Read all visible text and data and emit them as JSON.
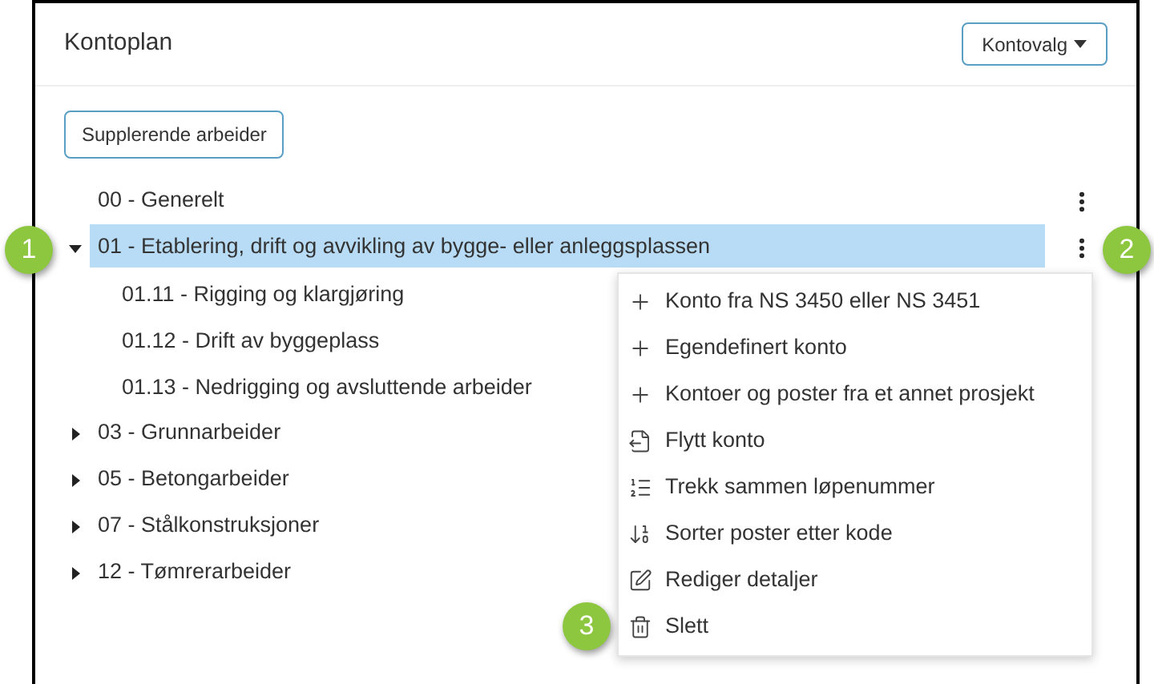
{
  "header": {
    "title": "Kontoplan",
    "options_button": "Kontovalg"
  },
  "supplementary_button": "Supplerende arbeider",
  "tree": [
    {
      "label": "00 - Generelt",
      "selected": false
    },
    {
      "label": "01 - Etablering, drift og avvikling av bygge- eller anleggsplassen",
      "expanded": true,
      "selected": true,
      "children": [
        {
          "label": "01.11 - Rigging og klargjøring"
        },
        {
          "label": "01.12 - Drift av byggeplass"
        },
        {
          "label": "01.13 - Nedrigging og avsluttende arbeider"
        }
      ]
    },
    {
      "label": "03 - Grunnarbeider",
      "expanded": false,
      "selected": false
    },
    {
      "label": "05 - Betongarbeider",
      "expanded": false,
      "selected": false
    },
    {
      "label": "07 - Stålkonstruksjoner",
      "expanded": false,
      "selected": false
    },
    {
      "label": "12 - Tømrerarbeider",
      "expanded": false,
      "selected": false
    }
  ],
  "context_menu": [
    {
      "kind": "add",
      "label": "Konto fra NS 3450 eller NS 3451"
    },
    {
      "kind": "add",
      "label": "Egendefinert konto"
    },
    {
      "kind": "add",
      "label": "Kontoer og poster fra et annet prosjekt"
    },
    {
      "kind": "move",
      "label": "Flytt konto"
    },
    {
      "kind": "list",
      "label": "Trekk sammen løpenummer"
    },
    {
      "kind": "sort",
      "label": "Sorter poster etter kode"
    },
    {
      "kind": "edit",
      "label": "Rediger detaljer"
    },
    {
      "kind": "delete",
      "label": "Slett"
    }
  ],
  "callouts": [
    "1",
    "2",
    "3"
  ]
}
